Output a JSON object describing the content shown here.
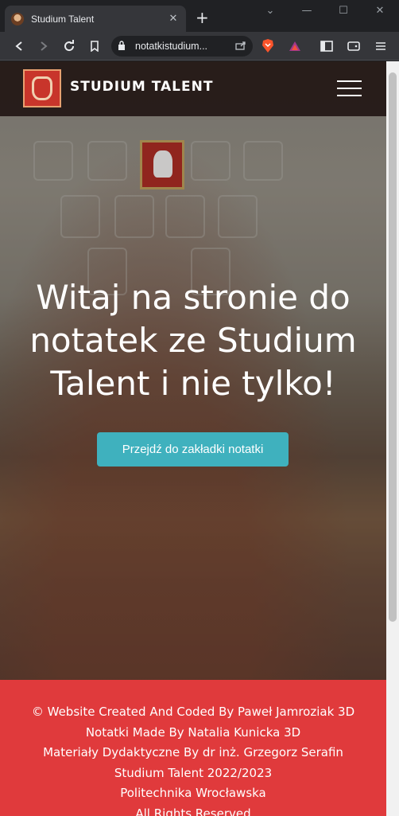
{
  "browser": {
    "tab_title": "Studium Talent",
    "url": "notatkistudium...",
    "close_glyph": "✕",
    "new_tab_glyph": "+"
  },
  "site": {
    "brand": "STUDIUM TALENT",
    "hero_heading": "Witaj na stronie do notatek ze Studium Talent i nie tylko!",
    "cta_label": "Przejdź do zakładki notatki",
    "footer_lines": [
      "© Website Created And Coded By Paweł Jamroziak 3D",
      "Notatki Made By Natalia Kunicka 3D",
      "Materiały Dydaktyczne By dr inż. Grzegorz Serafin",
      "Studium Talent 2022/2023",
      "Politechnika Wrocławska",
      "All Rights Reserved"
    ]
  },
  "colors": {
    "cta": "#3fb1be",
    "footer": "#e03a3c",
    "navbar": "#221614"
  }
}
